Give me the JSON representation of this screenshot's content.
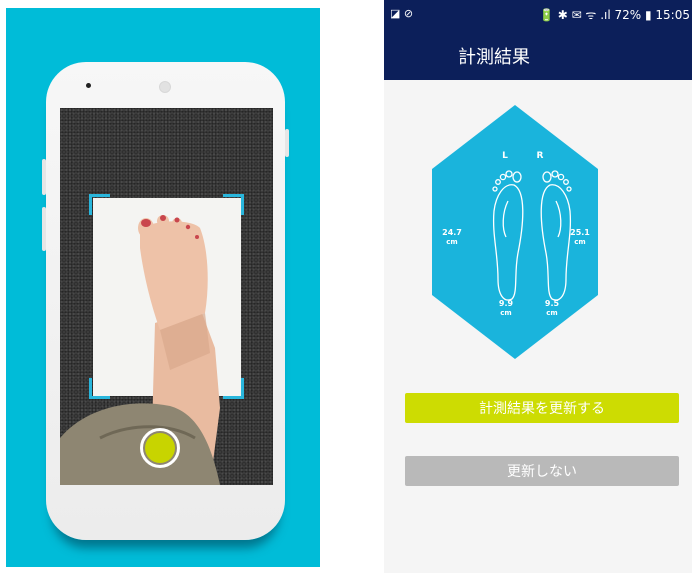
{
  "colors": {
    "left_background": "#00bcd8",
    "app_bar": "#0c1f5a",
    "hexagon": "#1ab4dc",
    "update_button": "#cddc02",
    "no_update_button": "#b9b9b9",
    "shutter": "#c8d400",
    "frame_corner": "#29b6dc"
  },
  "camera_screen": {
    "shutter_icon": "shutter-button",
    "frame_icon": "scan-frame-corners"
  },
  "status_bar": {
    "left_icons": "◪ ⊘",
    "right_text": "🔋 ✱ ✉ ᯤ .ıl 72% ▮ 15:05"
  },
  "app_bar": {
    "title": "計測結果"
  },
  "measurement": {
    "left_label": "L",
    "right_label": "R",
    "left_length_value": "24.7",
    "left_length_unit": "cm",
    "right_length_value": "25.1",
    "right_length_unit": "cm",
    "left_width_value": "9.9",
    "left_width_unit": "cm",
    "right_width_value": "9.5",
    "right_width_unit": "cm"
  },
  "buttons": {
    "update_label": "計測結果を更新する",
    "no_update_label": "更新しない"
  }
}
